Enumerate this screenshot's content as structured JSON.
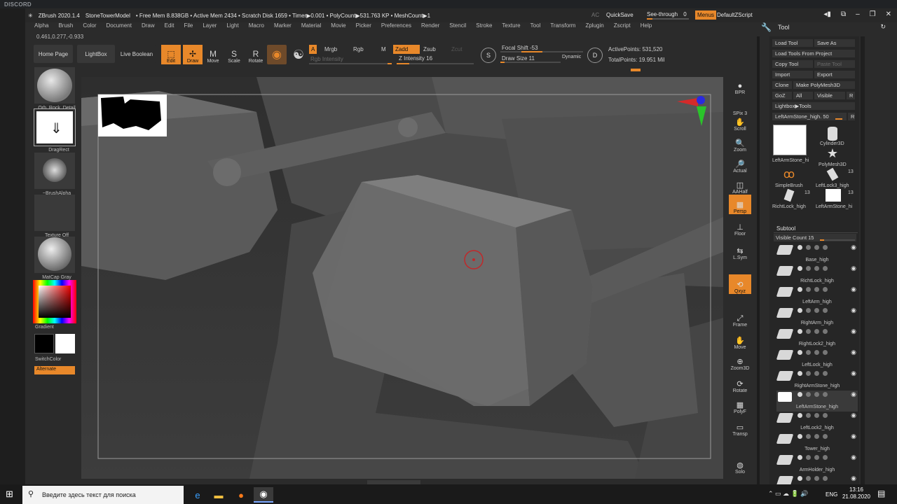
{
  "discord": {
    "label": "DISCORD"
  },
  "titlebar": {
    "app": "ZBrush 2020.1.4",
    "model": "StoneTowerModel",
    "mem": "• Free Mem 8.838GB • Active Mem 2434 • Scratch Disk 1659 • Timer▶0.001 • PolyCount▶531.763 KP • MeshCount▶1",
    "ac": "AC",
    "quicksave": "QuickSave",
    "see_through_label": "See-through",
    "see_through_value": "0",
    "see_through_level": 0,
    "menus": "Menus",
    "script": "DefaultZScript"
  },
  "menubar": [
    "Alpha",
    "Brush",
    "Color",
    "Document",
    "Draw",
    "Edit",
    "File",
    "Layer",
    "Light",
    "Macro",
    "Marker",
    "Material",
    "Movie",
    "Picker",
    "Preferences",
    "Render",
    "Stencil",
    "Stroke",
    "Texture",
    "Tool",
    "Transform",
    "Zplugin",
    "Zscript",
    "Help"
  ],
  "coords": "0.461,0.277,-0.933",
  "toolbar": {
    "home": "Home Page",
    "lightbox": "LightBox",
    "liveboolean": "Live Boolean",
    "edit": "Edit",
    "draw": "Draw",
    "move": "Move",
    "scale": "Scale",
    "rotate": "Rotate",
    "a": "A",
    "mrgb": "Mrgb",
    "rgb": "Rgb",
    "m": "M",
    "zadd": "Zadd",
    "zsub": "Zsub",
    "zcut": "Zcut",
    "rgb_intensity": "Rgb Intensity",
    "z_intensity": "Z Intensity 16",
    "z_intensity_level": 16,
    "focal_shift": "Focal Shift -53",
    "draw_size": "Draw Size 11",
    "dynamic": "Dynamic",
    "active_points": "ActivePoints: 531,520",
    "total_points": "TotalPoints: 19.951 Mil"
  },
  "leftshelf": {
    "brush": "Orb_Rock_Detail",
    "stroke": "DragRect",
    "alpha": "~BrushAlpha",
    "texture": "Texture Off",
    "material": "MatCap Gray",
    "gradient": "Gradient",
    "switchcolor": "SwitchColor",
    "alternate": "Alternate"
  },
  "rightshelf": [
    "BPR",
    "SPix 3",
    "Scroll",
    "Zoom",
    "Actual",
    "AAHalf",
    "Persp",
    "Floor",
    "L.Sym",
    "Qxyz",
    "Frame",
    "Move",
    "Zoom3D",
    "Rotate",
    "PolyF",
    "Transp",
    "Solo"
  ],
  "toolpanel": {
    "title": "Tool",
    "load_tool": "Load Tool",
    "save_as": "Save As",
    "load_from_project": "Load Tools From Project",
    "copy_tool": "Copy Tool",
    "paste_tool": "Paste Tool",
    "import": "Import",
    "export": "Export",
    "clone": "Clone",
    "make_polymesh": "Make PolyMesh3D",
    "goz": "GoZ",
    "all": "All",
    "visible": "Visible",
    "r": "R",
    "lightbox_tools": "Lightbox▶Tools",
    "current_tool": "LeftArmStone_high. 50",
    "tools": [
      {
        "name": "LeftArmStone_hi",
        "count": ""
      },
      {
        "name": "Cylinder3D",
        "count": ""
      },
      {
        "name": "PolyMesh3D",
        "count": ""
      },
      {
        "name": "SimpleBrush",
        "count": ""
      },
      {
        "name": "LeftLock3_high",
        "count": "13"
      },
      {
        "name": "RichtLock_high",
        "count": "13"
      },
      {
        "name": "LeftArmStone_hi",
        "count": "13"
      }
    ]
  },
  "subtool": {
    "title": "Subtool",
    "visible_count": "Visible Count 15",
    "items": [
      "Base_high",
      "RichtLock_high",
      "LeftArm_high",
      "RightArm_high",
      "RightLock2_high",
      "LeftLock_high",
      "RightArmStone_high",
      "LeftArmStone_high",
      "LeftLock2_high",
      "Tower_high",
      "ArmHolder_high"
    ]
  },
  "taskbar": {
    "search_placeholder": "Введите здесь текст для поиска",
    "lang": "ENG",
    "time": "13:16",
    "date": "21.08.2020"
  }
}
